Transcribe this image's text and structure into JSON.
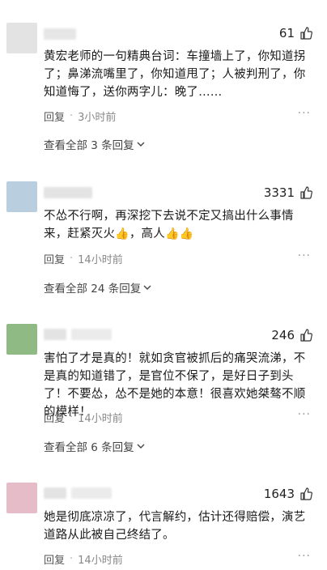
{
  "comments": [
    {
      "avatar_color": "#e3e3e3",
      "likes": "61",
      "text": "黄宏老师的一句精典台词：车撞墙上了，你知道拐了；鼻涕流嘴里了，你知道甩了；人被判刑了，你知道悔了，送你两字儿：晚了……",
      "reply_label": "回复",
      "time": "3小时前",
      "more": "···",
      "view_all": "查看全部 3 条回复"
    },
    {
      "avatar_color": "#b9cedf",
      "likes": "3331",
      "text_main": "不怂不行啊，再深挖下去说不定又搞出什么事情来，赶紧灭火",
      "text_mid": "，高人",
      "emoji_icon": "thumbs-up-emoji",
      "reply_label": "回复",
      "time": "14小时前",
      "more": "···",
      "view_all": "查看全部 24 条回复"
    },
    {
      "avatar_color": "#8fba84",
      "likes": "246",
      "text": "害怕了才是真的！就如贪官被抓后的痛哭流涕，不是真的知道错了，是官位不保了，是好日子到头了！不要怂，怂不是她的本意！很喜欢她桀骜不顺的模样！",
      "reply_label": "回复",
      "time": "14小时前",
      "more": "···",
      "view_all": "查看全部 6 条回复"
    },
    {
      "avatar_color": "#e7bcc9",
      "likes": "1643",
      "text": "她是彻底凉凉了，代言解约，估计还得赔偿，演艺道路从此被自己终结了。",
      "reply_label": "回复",
      "time": "14小时前",
      "more": "···"
    }
  ]
}
